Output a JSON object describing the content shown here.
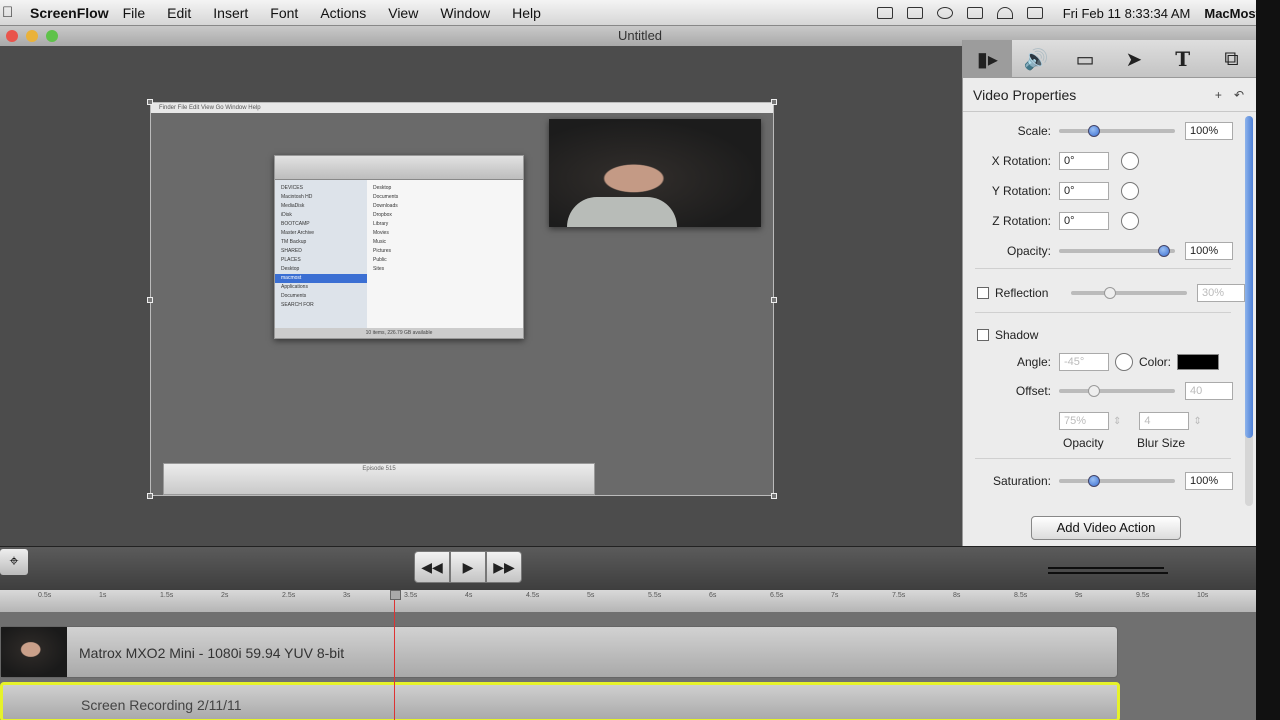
{
  "menubar": {
    "app_name": "ScreenFlow",
    "menus": [
      "File",
      "Edit",
      "Insert",
      "Font",
      "Actions",
      "View",
      "Window",
      "Help"
    ],
    "clock": "Fri Feb 11  8:33:34 AM",
    "user": "MacMost"
  },
  "window": {
    "title": "Untitled"
  },
  "canvas": {
    "mini_menubar_text": "Finder  File  Edit  View  Go  Window  Help",
    "finder": {
      "sidebar": [
        "DEVICES",
        "Macintosh HD",
        "MediaDisk",
        "iDisk",
        "BOOTCAMP",
        "Master Archive",
        "TM Backup",
        "SHARED",
        "PLACES",
        "Desktop",
        "macmost",
        "Applications",
        "Documents",
        "SEARCH FOR"
      ],
      "selected": "macmost",
      "files": [
        "Desktop",
        "Documents",
        "Downloads",
        "Dropbox",
        "Library",
        "Movies",
        "Music",
        "Pictures",
        "Public",
        "Sites"
      ],
      "status": "10 items, 226.79 GB available"
    },
    "bottom_window_title": "Episode 515"
  },
  "panel": {
    "tabs": [
      "video-camera-icon",
      "speaker-icon",
      "monitor-icon",
      "pointer-icon",
      "text-icon",
      "callout-icon"
    ],
    "title": "Video Properties",
    "scale_label": "Scale:",
    "scale_value": "100%",
    "scale_level": 0.28,
    "xrot_label": "X Rotation:",
    "xrot_value": "0°",
    "yrot_label": "Y Rotation:",
    "yrot_value": "0°",
    "zrot_label": "Z Rotation:",
    "zrot_value": "0°",
    "opacity_label": "Opacity:",
    "opacity_value": "100%",
    "opacity_level": 0.95,
    "reflection_label": "Reflection",
    "reflection_value": "30%",
    "reflection_level": 0.32,
    "shadow_label": "Shadow",
    "angle_label": "Angle:",
    "angle_value": "-45°",
    "color_label": "Color:",
    "shadow_color": "#000000",
    "offset_label": "Offset:",
    "offset_value": "40",
    "offset_level": 0.28,
    "shadow_opacity_value": "75%",
    "blur_value": "4",
    "shadow_opacity_label": "Opacity",
    "blur_label": "Blur Size",
    "saturation_label": "Saturation:",
    "saturation_value": "100%",
    "saturation_level": 0.28,
    "add_action_label": "Add Video Action"
  },
  "timeline": {
    "ruler_ticks": [
      "0.5s",
      "1s",
      "1.5s",
      "2s",
      "2.5s",
      "3s",
      "3.5s",
      "4s",
      "4.5s",
      "5s",
      "5.5s",
      "6s",
      "6.5s",
      "7s",
      "7.5s",
      "8s",
      "8.5s",
      "9s",
      "9.5s",
      "10s"
    ],
    "clip1_label": "Matrox MXO2 Mini - 1080i 59.94 YUV 8-bit",
    "clip2_label": "Screen Recording 2/11/11"
  },
  "colors": {
    "accent": "#3b6fd3",
    "clip_highlight": "#e6f22a",
    "playhead": "#dd3333"
  }
}
